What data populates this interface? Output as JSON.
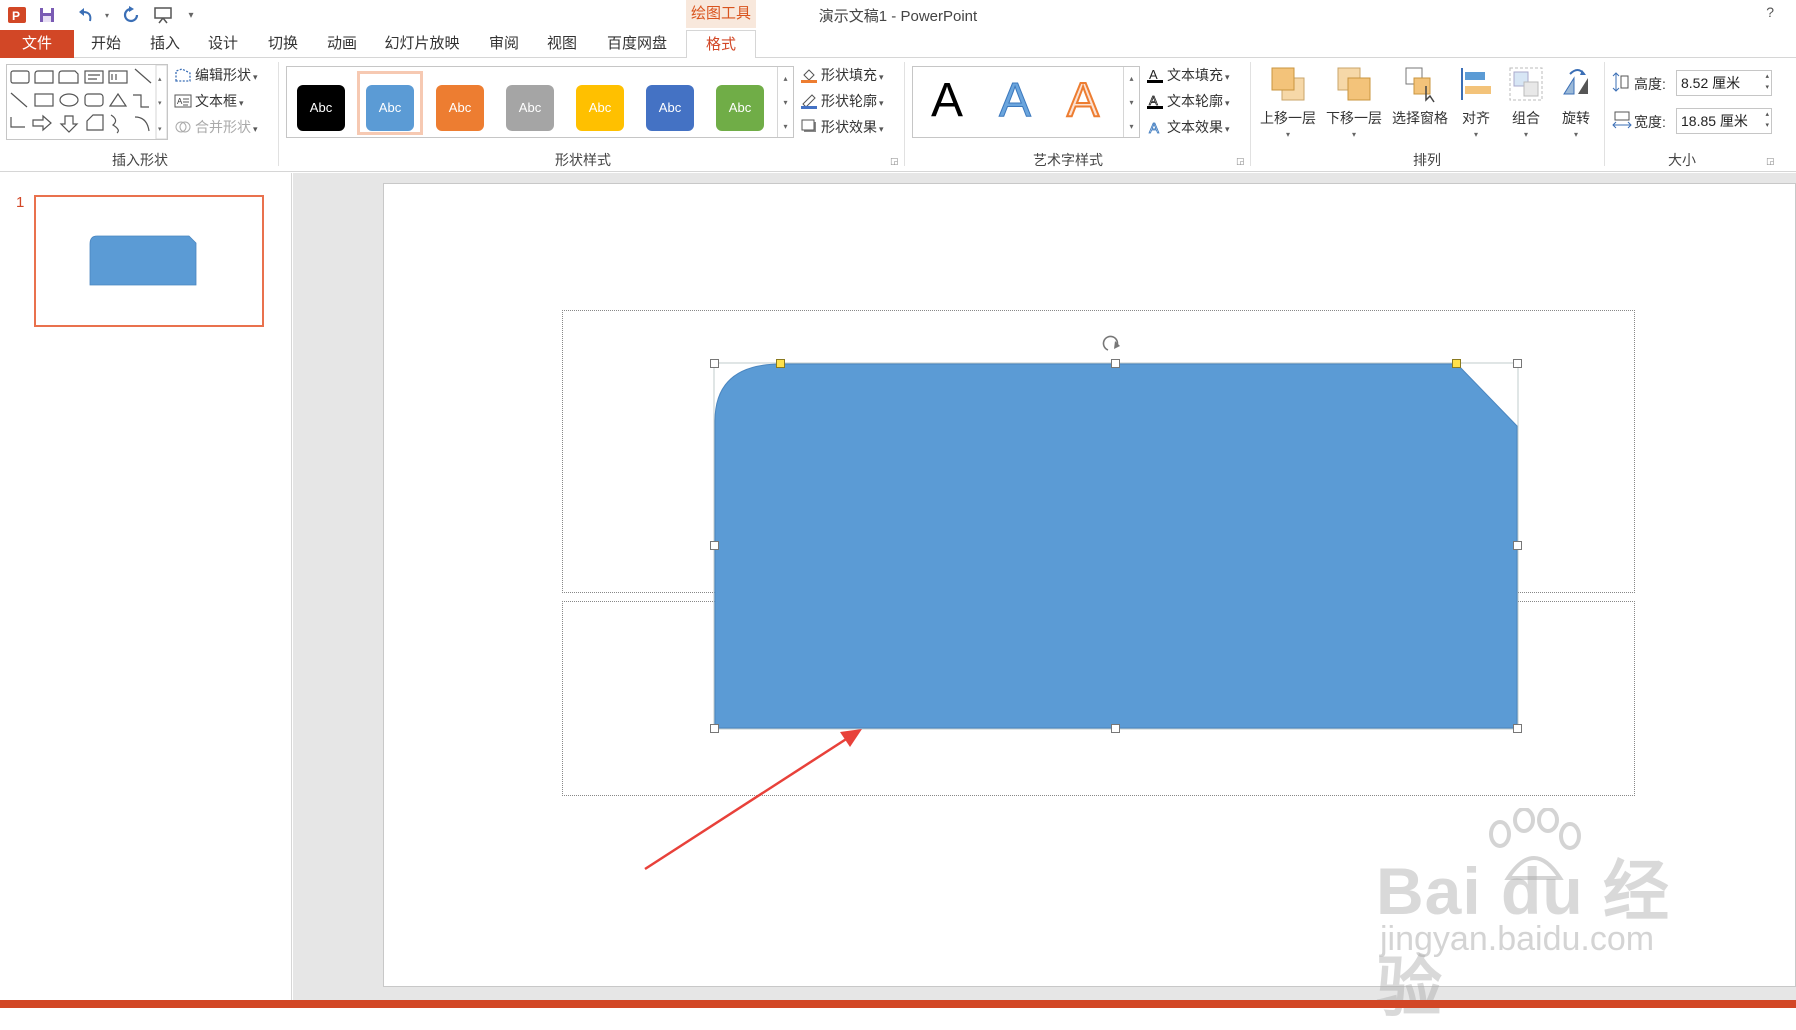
{
  "titlebar": {
    "title": "演示文稿1 - PowerPoint",
    "context_tab": "绘图工具",
    "help": "?",
    "quick_access": [
      "ppt-app-icon",
      "save-icon",
      "undo-icon",
      "redo-icon",
      "slideshow-icon",
      "customize-icon"
    ]
  },
  "tabs": [
    {
      "label": "文件",
      "name": "tab-file"
    },
    {
      "label": "开始",
      "name": "tab-home"
    },
    {
      "label": "插入",
      "name": "tab-insert"
    },
    {
      "label": "设计",
      "name": "tab-design"
    },
    {
      "label": "切换",
      "name": "tab-transitions"
    },
    {
      "label": "动画",
      "name": "tab-animations"
    },
    {
      "label": "幻灯片放映",
      "name": "tab-slideshow"
    },
    {
      "label": "审阅",
      "name": "tab-review"
    },
    {
      "label": "视图",
      "name": "tab-view"
    },
    {
      "label": "百度网盘",
      "name": "tab-baidu"
    },
    {
      "label": "格式",
      "name": "tab-format"
    }
  ],
  "ribbon": {
    "insert_shapes": {
      "label": "插入形状",
      "edit_shape": "编辑形状",
      "text_box": "文本框",
      "merge_shapes": "合并形状"
    },
    "shape_styles": {
      "label": "形状样式",
      "styles": [
        {
          "text": "Abc",
          "color": "#000000"
        },
        {
          "text": "Abc",
          "color": "#5b9bd5",
          "selected": true
        },
        {
          "text": "Abc",
          "color": "#ed7d31"
        },
        {
          "text": "Abc",
          "color": "#a5a5a5"
        },
        {
          "text": "Abc",
          "color": "#ffc000"
        },
        {
          "text": "Abc",
          "color": "#4472c4"
        },
        {
          "text": "Abc",
          "color": "#70ad47"
        }
      ],
      "fill": "形状填充",
      "outline": "形状轮廓",
      "effects": "形状效果"
    },
    "wordart_styles": {
      "label": "艺术字样式",
      "letters": [
        "A",
        "A",
        "A"
      ],
      "text_fill": "文本填充",
      "text_outline": "文本轮廓",
      "text_effects": "文本效果"
    },
    "arrange": {
      "label": "排列",
      "bring_forward": "上移一层",
      "send_backward": "下移一层",
      "selection_pane": "选择窗格",
      "align": "对齐",
      "group": "组合",
      "rotate": "旋转"
    },
    "size": {
      "label": "大小",
      "height_label": "高度:",
      "height_value": "8.52 厘米",
      "width_label": "宽度:",
      "width_value": "18.85 厘米"
    }
  },
  "slides_pane": {
    "slide_number": "1"
  },
  "canvas": {
    "shape_fill": "#5b9bd5",
    "arrow_color": "#e8413a"
  },
  "watermark": {
    "text": "Bai du 经验",
    "url": "jingyan.baidu.com"
  },
  "colors": {
    "accent": "#d24726",
    "context_tab_bg": "#f8e8dc"
  }
}
